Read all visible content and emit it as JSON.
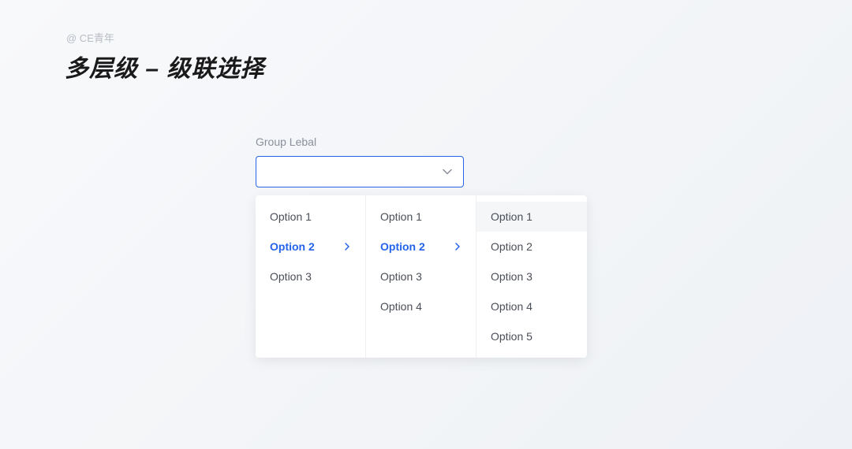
{
  "credit": "@ CE青年",
  "title": "多层级 – 级联选择",
  "form": {
    "label": "Group Lebal",
    "value": ""
  },
  "cascade": {
    "columns": [
      {
        "options": [
          {
            "label": "Option 1",
            "selected": false,
            "hasChildren": false
          },
          {
            "label": "Option 2",
            "selected": true,
            "hasChildren": true
          },
          {
            "label": "Option 3",
            "selected": false,
            "hasChildren": false
          }
        ]
      },
      {
        "options": [
          {
            "label": "Option 1",
            "selected": false,
            "hasChildren": false
          },
          {
            "label": "Option 2",
            "selected": true,
            "hasChildren": true
          },
          {
            "label": "Option 3",
            "selected": false,
            "hasChildren": false
          },
          {
            "label": "Option 4",
            "selected": false,
            "hasChildren": false
          }
        ]
      },
      {
        "options": [
          {
            "label": "Option 1",
            "selected": false,
            "hovered": true,
            "hasChildren": false
          },
          {
            "label": "Option 2",
            "selected": false,
            "hasChildren": false
          },
          {
            "label": "Option 3",
            "selected": false,
            "hasChildren": false
          },
          {
            "label": "Option 4",
            "selected": false,
            "hasChildren": false
          },
          {
            "label": "Option 5",
            "selected": false,
            "hasChildren": false
          }
        ]
      }
    ]
  },
  "colors": {
    "accent": "#2563eb",
    "text": "#4a4e57",
    "muted": "#8a8f99"
  }
}
